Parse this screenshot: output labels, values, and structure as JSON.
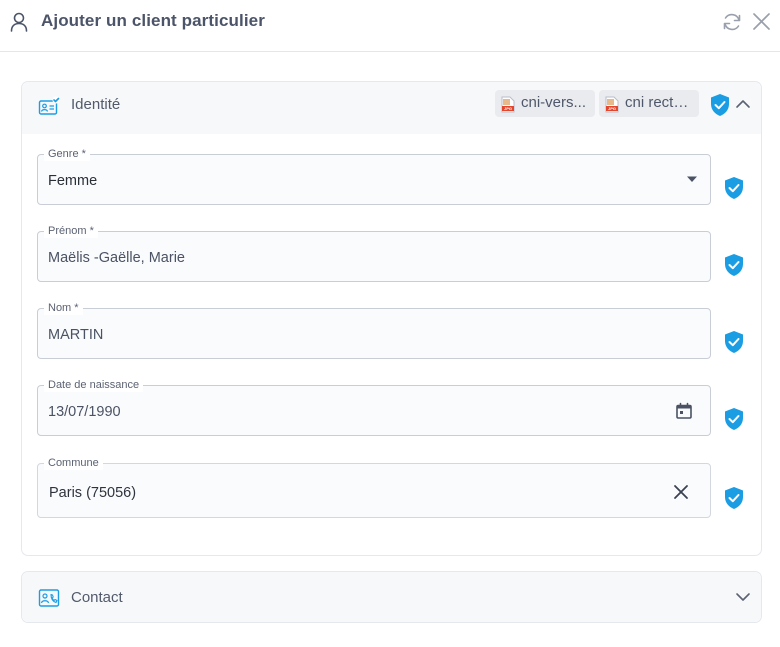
{
  "header": {
    "title": "Ajouter un client particulier",
    "icons": [
      "user-icon",
      "refresh-icon",
      "close-icon"
    ]
  },
  "identity": {
    "title": "Identité",
    "icon": "id-card-icon",
    "attachments": [
      {
        "label": "cni-verso.jpg",
        "display": "cni-vers...",
        "icon": "jpg-file-icon"
      },
      {
        "label": "cni recto.jpg",
        "display": "cni recto ...",
        "icon": "jpg-file-icon"
      }
    ],
    "expanded": true,
    "fields": {
      "genre": {
        "label": "Genre *",
        "value": "Femme"
      },
      "prenom": {
        "label": "Prénom *",
        "value": "Maëlis -Gaëlle, Marie"
      },
      "nom": {
        "label": "Nom *",
        "value": "MARTIN"
      },
      "date": {
        "label": "Date de naissance",
        "value": "13/07/1990"
      },
      "commune": {
        "label": "Commune",
        "value": "Paris (75056)"
      }
    }
  },
  "contact": {
    "title": "Contact",
    "icon": "contact-card-icon",
    "expanded": false
  },
  "colors": {
    "accent": "#1b9de3",
    "border": "#c9cdd6",
    "text": "#4a5264",
    "header_bg": "#f6f8fa"
  }
}
